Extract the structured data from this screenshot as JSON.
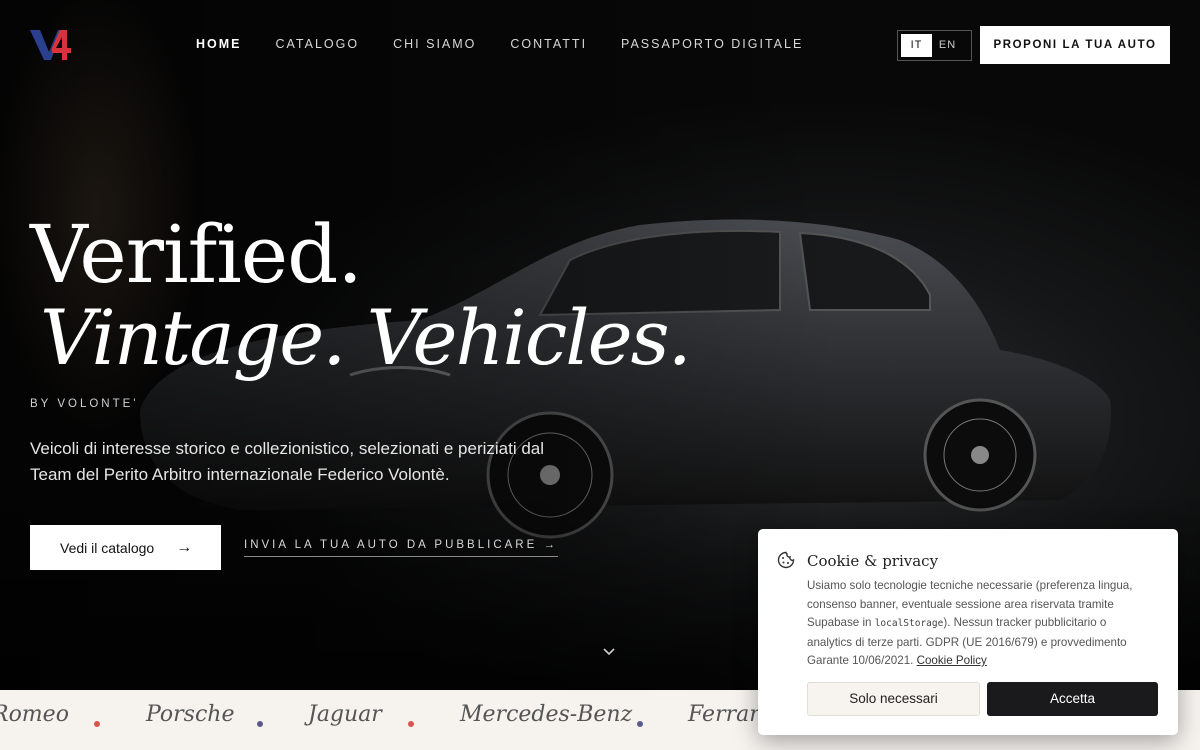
{
  "header": {
    "logo_text": "V4",
    "nav": [
      {
        "label": "HOME",
        "active": true
      },
      {
        "label": "CATALOGO",
        "active": false
      },
      {
        "label": "CHI SIAMO",
        "active": false
      },
      {
        "label": "CONTATTI",
        "active": false
      },
      {
        "label": "PASSAPORTO DIGITALE",
        "active": false
      }
    ],
    "lang": {
      "options": [
        "IT",
        "EN"
      ],
      "selected": "IT"
    },
    "propose_button": "PROPONI LA TUA AUTO"
  },
  "hero": {
    "headline_1": "Verified.",
    "headline_2": "Vintage. Vehicles.",
    "byline": "BY VOLONTE'",
    "lead": "Veicoli di interesse storico e collezionistico, selezionati e periziati dal Team del Perito Arbitro internazionale Federico Volontè.",
    "cta_label": "Vedi il catalogo",
    "cta_icon": "arrow-right-icon",
    "secondary_link": "INVIA LA TUA AUTO DA PUBBLICARE →",
    "scroll_icon": "chevron-down-icon"
  },
  "brands": {
    "items": [
      "Romeo",
      "Porsche",
      "Jaguar",
      "Mercedes-Benz",
      "Ferrari"
    ],
    "dot_colors": [
      "#d9534f",
      "#5a5a8a"
    ]
  },
  "cookie": {
    "title": "Cookie & privacy",
    "text_before": "Usiamo solo tecnologie tecniche necessarie (preferenza lingua, consenso banner, eventuale sessione area riservata tramite Supabase in ",
    "code": "localStorage",
    "text_after": "). Nessun tracker pubblicitario o analytics di terze parti. GDPR (UE 2016/679) e provvedimento Garante 10/06/2021. ",
    "link": "Cookie Policy",
    "btn_necessary": "Solo necessari",
    "btn_accept": "Accetta"
  },
  "colors": {
    "logo_blue": "#2b3f8f",
    "logo_red": "#d8323c",
    "dark": "#1a1a1d"
  }
}
